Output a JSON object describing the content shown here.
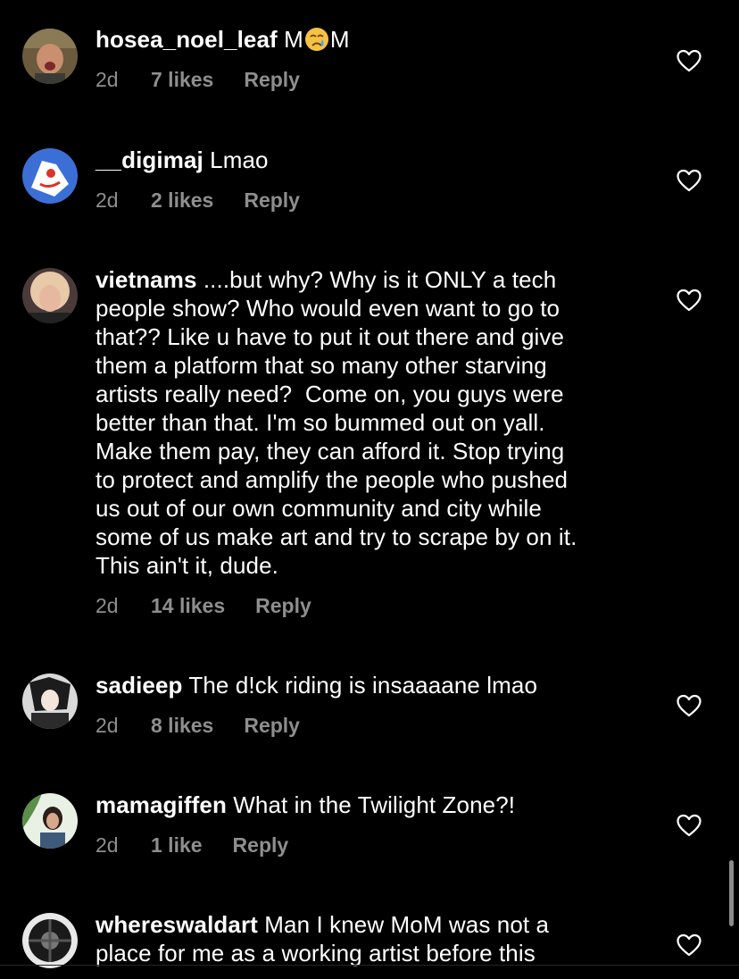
{
  "theme": {
    "background": "#000000",
    "text_primary": "#ffffff",
    "text_secondary": "#8e8e8e",
    "icon_color": "#ffffff"
  },
  "comments": [
    {
      "username": "hosea_noel_leaf",
      "text_before": "M",
      "emoji": "crying-face-emoji",
      "text_after": "M",
      "time": "2d",
      "likes": "7 likes",
      "reply": "Reply",
      "like_icon": "heart-outline-icon"
    },
    {
      "username": "__digimaj",
      "text": "Lmao",
      "time": "2d",
      "likes": "2 likes",
      "reply": "Reply",
      "like_icon": "heart-outline-icon"
    },
    {
      "username": "vietnams",
      "lines": [
        "....but why? Why is it ONLY a tech",
        "people show? Who would even want to go to",
        "that?? Like u have to put it out there and give",
        "them a platform that so many other starving",
        "artists really need?  Come on, you guys were",
        "better than that. I'm so bummed out on yall.",
        "Make them pay, they can afford it. Stop trying",
        "to protect and amplify the people who pushed",
        "us out of our own community and city while",
        "some of us make art and try to scrape by on it.",
        "This ain't it, dude."
      ],
      "time": "2d",
      "likes": "14 likes",
      "reply": "Reply",
      "like_icon": "heart-outline-icon"
    },
    {
      "username": "sadieep",
      "text": "The d!ck riding is insaaaane lmao",
      "time": "2d",
      "likes": "8 likes",
      "reply": "Reply",
      "like_icon": "heart-outline-icon"
    },
    {
      "username": "mamagiffen",
      "text": "What in the Twilight Zone?!",
      "time": "2d",
      "likes": "1 like",
      "reply": "Reply",
      "like_icon": "heart-outline-icon"
    },
    {
      "username": "whereswaldart",
      "lines": [
        "Man I knew MoM was not a",
        "place for me as a working artist before this"
      ],
      "like_icon": "heart-outline-icon"
    }
  ]
}
